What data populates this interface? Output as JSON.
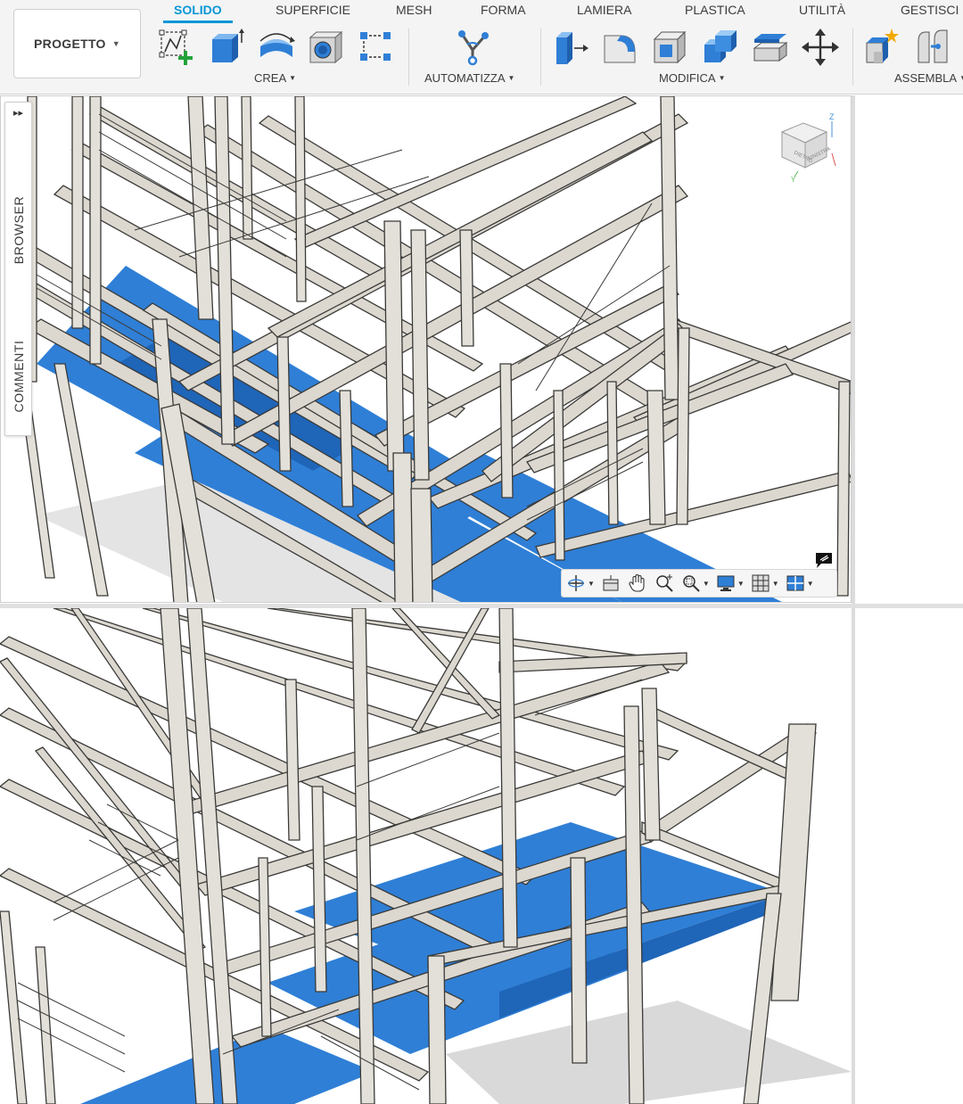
{
  "project": {
    "label": "PROGETTO"
  },
  "tabs": [
    "SOLIDO",
    "SUPERFICIE",
    "MESH",
    "FORMA",
    "LAMIERA",
    "PLASTICA",
    "UTILITÀ",
    "GESTISCI"
  ],
  "active_tab": "SOLIDO",
  "groups": {
    "crea": "CREA",
    "automatizza": "AUTOMATIZZA",
    "modifica": "MODIFICA",
    "assembla": "ASSEMBLA"
  },
  "tools": {
    "crea": [
      "create-sketch-icon",
      "extrude-icon",
      "revolve-icon",
      "hole-icon",
      "pattern-icon"
    ],
    "automatizza": [
      "automate-icon"
    ],
    "modifica": [
      "press-pull-icon",
      "fillet-icon",
      "shell-icon",
      "combine-icon",
      "offset-face-icon",
      "move-icon"
    ],
    "assembla": [
      "new-component-icon",
      "joint-icon"
    ]
  },
  "side_panel": {
    "browser": "BROWSER",
    "comments": "COMMENTI"
  },
  "viewcube": {
    "front": "DIETRO",
    "side": "SINISTRA",
    "axis_z": "Z",
    "axis_x": "X",
    "axis_y": "Y"
  },
  "navbar": [
    "orbit-icon",
    "look-at-icon",
    "pan-icon",
    "zoom-icon",
    "fit-icon",
    "display-settings-icon",
    "grid-icon",
    "viewports-icon"
  ],
  "colors": {
    "accent": "#0696d7",
    "floor_blue": "#2f7fd6",
    "steel": "#d9d6ce",
    "edge": "#3a3a38"
  }
}
